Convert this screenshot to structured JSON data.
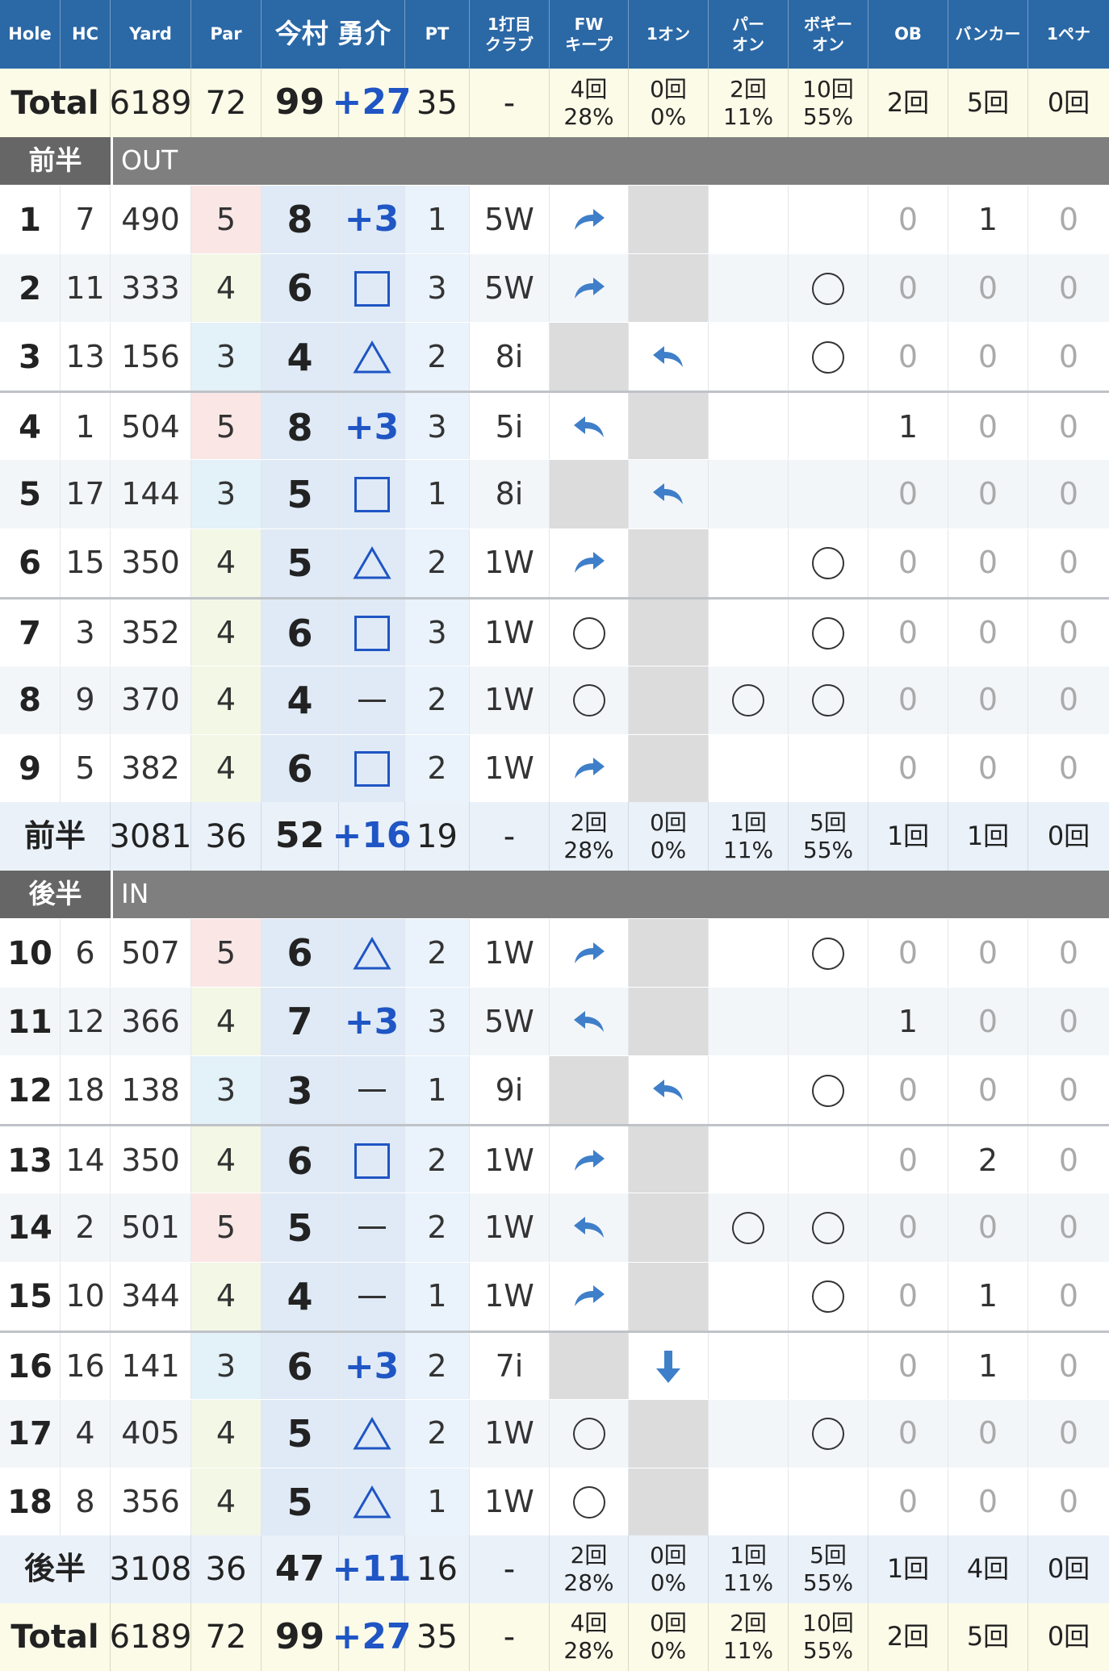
{
  "header": {
    "hole": "Hole",
    "hc": "HC",
    "yard": "Yard",
    "par": "Par",
    "player": "今村 勇介",
    "pt": "PT",
    "club_1": "1打目",
    "club_2": "クラブ",
    "fw_1": "FW",
    "fw_2": "キープ",
    "one_on": "1オン",
    "par_on_1": "パー",
    "par_on_2": "オン",
    "bogey_on_1": "ボギー",
    "bogey_on_2": "オン",
    "ob": "OB",
    "bunker": "バンカー",
    "penalty": "1ペナ"
  },
  "total_top": {
    "label": "Total",
    "yard": "6189",
    "par": "72",
    "score": "99",
    "diff": "+27",
    "pt": "35",
    "club": "-",
    "fw": "4回",
    "fw_pct": "28%",
    "one_on": "0回",
    "one_on_pct": "0%",
    "par_on": "2回",
    "par_on_pct": "11%",
    "bogey_on": "10回",
    "bogey_on_pct": "55%",
    "ob": "2回",
    "bunker": "5回",
    "penalty": "0回"
  },
  "section_out": {
    "label": "前半",
    "name": "OUT"
  },
  "section_in": {
    "label": "後半",
    "name": "IN"
  },
  "holes": [
    {
      "hole": "1",
      "hc": "7",
      "yard": "490",
      "par": "5",
      "score": "8",
      "mark": "plus",
      "mark_text": "+3",
      "pt": "1",
      "club": "5W",
      "fw": "right",
      "one_on": "na",
      "par_on": "",
      "bogey_on": "",
      "ob": "0",
      "bunker": "1",
      "penalty": "0"
    },
    {
      "hole": "2",
      "hc": "11",
      "yard": "333",
      "par": "4",
      "score": "6",
      "mark": "square",
      "mark_text": "",
      "pt": "3",
      "club": "5W",
      "fw": "right",
      "one_on": "na",
      "par_on": "",
      "bogey_on": "circle",
      "ob": "0",
      "bunker": "0",
      "penalty": "0"
    },
    {
      "hole": "3",
      "hc": "13",
      "yard": "156",
      "par": "3",
      "score": "4",
      "mark": "triangle",
      "mark_text": "",
      "pt": "2",
      "club": "8i",
      "fw": "na",
      "one_on": "left",
      "par_on": "",
      "bogey_on": "circle",
      "ob": "0",
      "bunker": "0",
      "penalty": "0"
    },
    {
      "hole": "4",
      "hc": "1",
      "yard": "504",
      "par": "5",
      "score": "8",
      "mark": "plus",
      "mark_text": "+3",
      "pt": "3",
      "club": "5i",
      "fw": "left",
      "one_on": "na",
      "par_on": "",
      "bogey_on": "",
      "ob": "1",
      "bunker": "0",
      "penalty": "0"
    },
    {
      "hole": "5",
      "hc": "17",
      "yard": "144",
      "par": "3",
      "score": "5",
      "mark": "square",
      "mark_text": "",
      "pt": "1",
      "club": "8i",
      "fw": "na",
      "one_on": "left",
      "par_on": "",
      "bogey_on": "",
      "ob": "0",
      "bunker": "0",
      "penalty": "0"
    },
    {
      "hole": "6",
      "hc": "15",
      "yard": "350",
      "par": "4",
      "score": "5",
      "mark": "triangle",
      "mark_text": "",
      "pt": "2",
      "club": "1W",
      "fw": "right",
      "one_on": "na",
      "par_on": "",
      "bogey_on": "circle",
      "ob": "0",
      "bunker": "0",
      "penalty": "0"
    },
    {
      "hole": "7",
      "hc": "3",
      "yard": "352",
      "par": "4",
      "score": "6",
      "mark": "square",
      "mark_text": "",
      "pt": "3",
      "club": "1W",
      "fw": "circle",
      "one_on": "na",
      "par_on": "",
      "bogey_on": "circle",
      "ob": "0",
      "bunker": "0",
      "penalty": "0"
    },
    {
      "hole": "8",
      "hc": "9",
      "yard": "370",
      "par": "4",
      "score": "4",
      "mark": "dash",
      "mark_text": "",
      "pt": "2",
      "club": "1W",
      "fw": "circle",
      "one_on": "na",
      "par_on": "circle",
      "bogey_on": "circle",
      "ob": "0",
      "bunker": "0",
      "penalty": "0"
    },
    {
      "hole": "9",
      "hc": "5",
      "yard": "382",
      "par": "4",
      "score": "6",
      "mark": "square",
      "mark_text": "",
      "pt": "2",
      "club": "1W",
      "fw": "right",
      "one_on": "na",
      "par_on": "",
      "bogey_on": "",
      "ob": "0",
      "bunker": "0",
      "penalty": "0"
    },
    {
      "hole": "10",
      "hc": "6",
      "yard": "507",
      "par": "5",
      "score": "6",
      "mark": "triangle",
      "mark_text": "",
      "pt": "2",
      "club": "1W",
      "fw": "right",
      "one_on": "na",
      "par_on": "",
      "bogey_on": "circle",
      "ob": "0",
      "bunker": "0",
      "penalty": "0"
    },
    {
      "hole": "11",
      "hc": "12",
      "yard": "366",
      "par": "4",
      "score": "7",
      "mark": "plus",
      "mark_text": "+3",
      "pt": "3",
      "club": "5W",
      "fw": "left",
      "one_on": "na",
      "par_on": "",
      "bogey_on": "",
      "ob": "1",
      "bunker": "0",
      "penalty": "0"
    },
    {
      "hole": "12",
      "hc": "18",
      "yard": "138",
      "par": "3",
      "score": "3",
      "mark": "dash",
      "mark_text": "",
      "pt": "1",
      "club": "9i",
      "fw": "na",
      "one_on": "left",
      "par_on": "",
      "bogey_on": "circle",
      "ob": "0",
      "bunker": "0",
      "penalty": "0"
    },
    {
      "hole": "13",
      "hc": "14",
      "yard": "350",
      "par": "4",
      "score": "6",
      "mark": "square",
      "mark_text": "",
      "pt": "2",
      "club": "1W",
      "fw": "right",
      "one_on": "na",
      "par_on": "",
      "bogey_on": "",
      "ob": "0",
      "bunker": "2",
      "penalty": "0"
    },
    {
      "hole": "14",
      "hc": "2",
      "yard": "501",
      "par": "5",
      "score": "5",
      "mark": "dash",
      "mark_text": "",
      "pt": "2",
      "club": "1W",
      "fw": "left",
      "one_on": "na",
      "par_on": "circle",
      "bogey_on": "circle",
      "ob": "0",
      "bunker": "0",
      "penalty": "0"
    },
    {
      "hole": "15",
      "hc": "10",
      "yard": "344",
      "par": "4",
      "score": "4",
      "mark": "dash",
      "mark_text": "",
      "pt": "1",
      "club": "1W",
      "fw": "right",
      "one_on": "na",
      "par_on": "",
      "bogey_on": "circle",
      "ob": "0",
      "bunker": "1",
      "penalty": "0"
    },
    {
      "hole": "16",
      "hc": "16",
      "yard": "141",
      "par": "3",
      "score": "6",
      "mark": "plus",
      "mark_text": "+3",
      "pt": "2",
      "club": "7i",
      "fw": "na",
      "one_on": "down",
      "par_on": "",
      "bogey_on": "",
      "ob": "0",
      "bunker": "1",
      "penalty": "0"
    },
    {
      "hole": "17",
      "hc": "4",
      "yard": "405",
      "par": "4",
      "score": "5",
      "mark": "triangle",
      "mark_text": "",
      "pt": "2",
      "club": "1W",
      "fw": "circle",
      "one_on": "na",
      "par_on": "",
      "bogey_on": "circle",
      "ob": "0",
      "bunker": "0",
      "penalty": "0"
    },
    {
      "hole": "18",
      "hc": "8",
      "yard": "356",
      "par": "4",
      "score": "5",
      "mark": "triangle",
      "mark_text": "",
      "pt": "1",
      "club": "1W",
      "fw": "circle",
      "one_on": "na",
      "par_on": "",
      "bogey_on": "",
      "ob": "0",
      "bunker": "0",
      "penalty": "0"
    }
  ],
  "subtotal_out": {
    "label": "前半",
    "yard": "3081",
    "par": "36",
    "score": "52",
    "diff": "+16",
    "pt": "19",
    "club": "-",
    "fw": "2回",
    "fw_pct": "28%",
    "one_on": "0回",
    "one_on_pct": "0%",
    "par_on": "1回",
    "par_on_pct": "11%",
    "bogey_on": "5回",
    "bogey_on_pct": "55%",
    "ob": "1回",
    "bunker": "1回",
    "penalty": "0回"
  },
  "subtotal_in": {
    "label": "後半",
    "yard": "3108",
    "par": "36",
    "score": "47",
    "diff": "+11",
    "pt": "16",
    "club": "-",
    "fw": "2回",
    "fw_pct": "28%",
    "one_on": "0回",
    "one_on_pct": "0%",
    "par_on": "1回",
    "par_on_pct": "11%",
    "bogey_on": "5回",
    "bogey_on_pct": "55%",
    "ob": "1回",
    "bunker": "4回",
    "penalty": "0回"
  },
  "total_bottom": {
    "label": "Total",
    "yard": "6189",
    "par": "72",
    "score": "99",
    "diff": "+27",
    "pt": "35",
    "club": "-",
    "fw": "4回",
    "fw_pct": "28%",
    "one_on": "0回",
    "one_on_pct": "0%",
    "par_on": "2回",
    "par_on_pct": "11%",
    "bogey_on": "10回",
    "bogey_on_pct": "55%",
    "ob": "2回",
    "bunker": "5回",
    "penalty": "0回"
  },
  "colors": {
    "header_bg": "#2b68a6",
    "plus_text": "#1f55c4",
    "square_border": "#1f55c4",
    "triangle_stroke": "#1f55c4",
    "arrow_fill": "#3f7fc9",
    "section_bg": "#7f7f7f",
    "par5_bg": "#fbe6e6",
    "par4_bg": "#f3f7e6",
    "par3_bg": "#e3f1f8"
  },
  "icons": {
    "fw_right": "curved-arrow-right-icon",
    "fw_left": "curved-arrow-left-icon",
    "down": "arrow-down-icon",
    "circle": "circle-mark-icon",
    "square": "square-mark-icon",
    "triangle": "triangle-mark-icon",
    "dash": "dash-mark-icon"
  }
}
